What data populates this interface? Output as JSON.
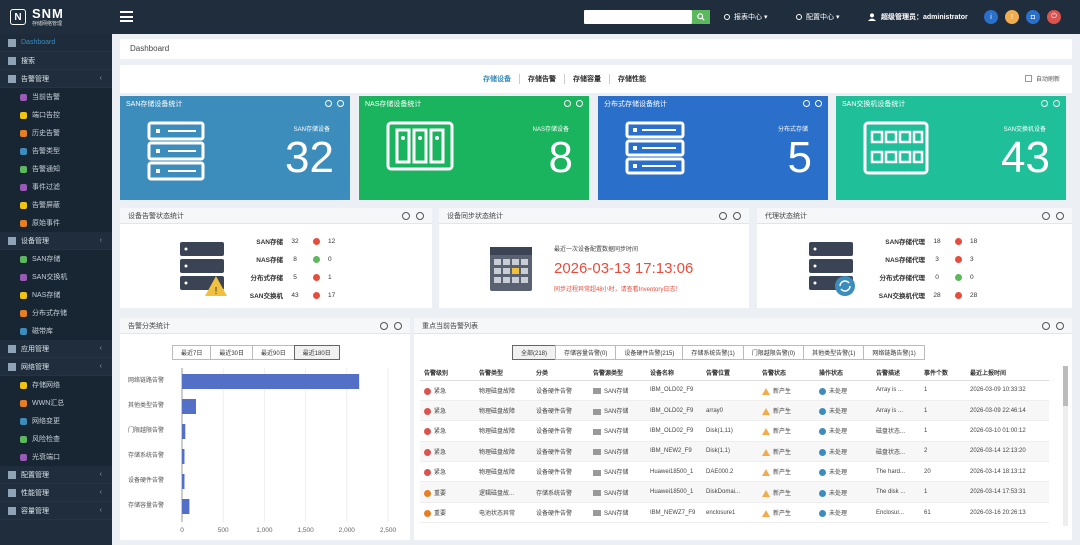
{
  "app": {
    "logo_letter": "N",
    "name": "SNM",
    "subtitle": "存储网络管理"
  },
  "sidebar": {
    "items": [
      {
        "label": "Dashboard",
        "type": "top",
        "active": true
      },
      {
        "label": "搜索",
        "type": "top"
      },
      {
        "label": "告警管理",
        "type": "group"
      },
      {
        "label": "当前告警",
        "type": "sub"
      },
      {
        "label": "端口告控",
        "type": "sub"
      },
      {
        "label": "历史告警",
        "type": "sub"
      },
      {
        "label": "告警类型",
        "type": "sub"
      },
      {
        "label": "告警通知",
        "type": "sub"
      },
      {
        "label": "事件过滤",
        "type": "sub"
      },
      {
        "label": "告警屏蔽",
        "type": "sub"
      },
      {
        "label": "原始事件",
        "type": "sub"
      },
      {
        "label": "设备管理",
        "type": "group"
      },
      {
        "label": "SAN存储",
        "type": "sub"
      },
      {
        "label": "SAN交换机",
        "type": "sub"
      },
      {
        "label": "NAS存储",
        "type": "sub"
      },
      {
        "label": "分布式存储",
        "type": "sub"
      },
      {
        "label": "磁带库",
        "type": "sub"
      },
      {
        "label": "应用管理",
        "type": "group"
      },
      {
        "label": "网络管理",
        "type": "group"
      },
      {
        "label": "存储网络",
        "type": "sub"
      },
      {
        "label": "WWN汇总",
        "type": "sub"
      },
      {
        "label": "网络变更",
        "type": "sub"
      },
      {
        "label": "风险检查",
        "type": "sub"
      },
      {
        "label": "光衰端口",
        "type": "sub"
      },
      {
        "label": "配置管理",
        "type": "group"
      },
      {
        "label": "性能管理",
        "type": "group"
      },
      {
        "label": "容量管理",
        "type": "group"
      }
    ]
  },
  "topbar": {
    "search_placeholder": "",
    "report_center": "报表中心",
    "config_center": "配置中心",
    "user_label": "超级管理员：administrator"
  },
  "breadcrumb": "Dashboard",
  "tabs": [
    "存储设备",
    "存储告警",
    "存储容量",
    "存储性能"
  ],
  "auto_refresh": "自动刷新",
  "cards": [
    {
      "title": "SAN存储设备统计",
      "label": "SAN存储设备",
      "value": "32",
      "color": "#3c8dbc"
    },
    {
      "title": "NAS存储设备统计",
      "label": "NAS存储设备",
      "value": "8",
      "color": "#1ab35e"
    },
    {
      "title": "分布式存储设备统计",
      "label": "分布式存储",
      "value": "5",
      "color": "#2a6fc9"
    },
    {
      "title": "SAN交换机设备统计",
      "label": "SAN交换机设备",
      "value": "43",
      "color": "#1fbf9a"
    }
  ],
  "device_alarm": {
    "title": "设备告警状态统计",
    "rows": [
      {
        "name": "SAN存储",
        "total": "32",
        "status": "red",
        "count": "12"
      },
      {
        "name": "NAS存储",
        "total": "8",
        "status": "green",
        "count": "0"
      },
      {
        "name": "分布式存储",
        "total": "5",
        "status": "red",
        "count": "1"
      },
      {
        "name": "SAN交换机",
        "total": "43",
        "status": "red",
        "count": "17"
      }
    ]
  },
  "sync": {
    "title": "设备同步状态统计",
    "caption": "最近一次设备配置数据同步时间",
    "time": "2026-03-13 17:13:06",
    "warning": "同步过程异常超48小时，请查看Inventory日志！"
  },
  "agent": {
    "title": "代理状态统计",
    "rows": [
      {
        "name": "SAN存储代理",
        "total": "18",
        "status": "red",
        "count": "18"
      },
      {
        "name": "NAS存储代理",
        "total": "3",
        "status": "red",
        "count": "3"
      },
      {
        "name": "分布式存储代理",
        "total": "0",
        "status": "green",
        "count": "0"
      },
      {
        "name": "SAN交换机代理",
        "total": "28",
        "status": "red",
        "count": "28"
      }
    ]
  },
  "alarm_category": {
    "title": "告警分类统计",
    "ranges": [
      "最近7日",
      "最近30日",
      "最近90日",
      "最近180日"
    ],
    "active_range": 3
  },
  "chart_data": {
    "type": "bar",
    "orientation": "horizontal",
    "categories": [
      "网络链路告警",
      "其他类型告警",
      "门限越限告警",
      "存储系统告警",
      "设备硬件告警",
      "存储容量告警"
    ],
    "values": [
      2150,
      170,
      40,
      30,
      30,
      90
    ],
    "xlim": [
      0,
      2500
    ],
    "xticks": [
      "0",
      "500",
      "1,000",
      "1,500",
      "2,000",
      "2,500"
    ],
    "color": "#5470c6"
  },
  "key_alarms": {
    "title": "重点当前告警列表",
    "filters": [
      "全部(218)",
      "存储容量告警(0)",
      "设备硬件告警(215)",
      "存储系统告警(1)",
      "门限越限告警(0)",
      "其他类型告警(1)",
      "网络链路告警(1)"
    ],
    "active_filter": 0,
    "columns": [
      "告警级别",
      "告警类型",
      "分类",
      "告警源类型",
      "设备名称",
      "告警位置",
      "告警状态",
      "操作状态",
      "告警描述",
      "事件个数",
      "最近上报时间"
    ],
    "rows": [
      {
        "level": "紧急",
        "lc": "#d9534f",
        "type": "物理磁盘故障",
        "cat": "设备硬件告警",
        "src": "SAN存储",
        "dev": "IBM_OLD02_F9",
        "loc": "",
        "state": "新产生",
        "op": "未处理",
        "desc": "Array is ...",
        "count": "1",
        "time": "2026-03-09 10:33:32"
      },
      {
        "level": "紧急",
        "lc": "#d9534f",
        "type": "物理磁盘故障",
        "cat": "设备硬件告警",
        "src": "SAN存储",
        "dev": "IBM_OLD02_F9",
        "loc": "array0",
        "state": "新产生",
        "op": "未处理",
        "desc": "Array is ...",
        "count": "1",
        "time": "2026-03-09 22:46:14"
      },
      {
        "level": "紧急",
        "lc": "#d9534f",
        "type": "物理磁盘故障",
        "cat": "设备硬件告警",
        "src": "SAN存储",
        "dev": "IBM_OLD02_F9",
        "loc": "Disk(1,11)",
        "state": "新产生",
        "op": "未处理",
        "desc": "磁盘状态...",
        "count": "1",
        "time": "2026-03-10 01:00:12"
      },
      {
        "level": "紧急",
        "lc": "#d9534f",
        "type": "物理磁盘故障",
        "cat": "设备硬件告警",
        "src": "SAN存储",
        "dev": "IBM_NEW2_F9",
        "loc": "Disk(1,1)",
        "state": "新产生",
        "op": "未处理",
        "desc": "磁盘状态...",
        "count": "2",
        "time": "2026-03-14 12:13:20"
      },
      {
        "level": "紧急",
        "lc": "#d9534f",
        "type": "物理磁盘故障",
        "cat": "设备硬件告警",
        "src": "SAN存储",
        "dev": "Huawei18500_1",
        "loc": "DAE000.2",
        "state": "新产生",
        "op": "未处理",
        "desc": "The hard...",
        "count": "20",
        "time": "2026-03-14 18:13:12"
      },
      {
        "level": "重要",
        "lc": "#e67e22",
        "type": "逻辑磁盘故...",
        "cat": "存储系统告警",
        "src": "SAN存储",
        "dev": "Huawei18500_1",
        "loc": "DiskDomai...",
        "state": "新产生",
        "op": "未处理",
        "desc": "The disk ...",
        "count": "1",
        "time": "2026-03-14 17:53:31"
      },
      {
        "level": "重要",
        "lc": "#e67e22",
        "type": "电池状态异常",
        "cat": "设备硬件告警",
        "src": "SAN存储",
        "dev": "IBM_NEWZ7_F9",
        "loc": "enclosure1",
        "state": "新产生",
        "op": "未处理",
        "desc": "Enclosur...",
        "count": "61",
        "time": "2026-03-16 20:26:13"
      }
    ]
  }
}
